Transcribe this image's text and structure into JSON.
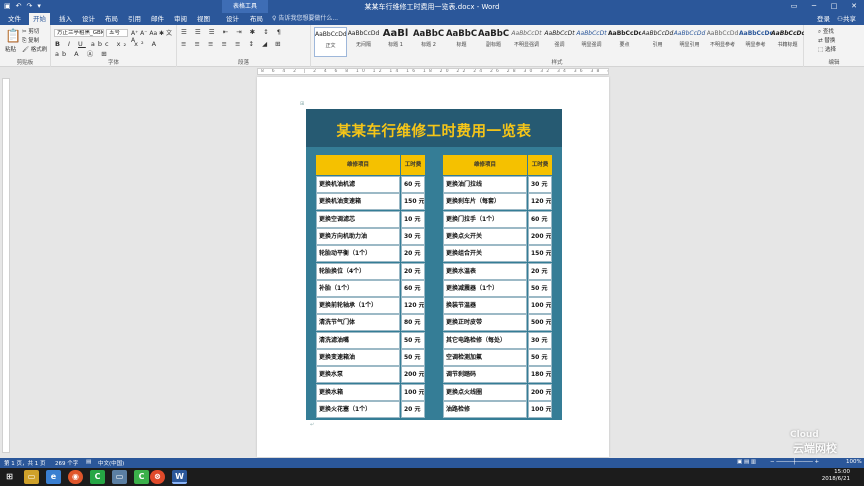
{
  "window": {
    "title": "某某车行维修工时费用一览表.docx - Word",
    "context_tab": "表格工具"
  },
  "tabs": [
    {
      "label": "文件",
      "active": false
    },
    {
      "label": "开始",
      "active": true
    },
    {
      "label": "插入",
      "active": false
    },
    {
      "label": "设计",
      "active": false
    },
    {
      "label": "布局",
      "active": false
    },
    {
      "label": "引用",
      "active": false
    },
    {
      "label": "邮件",
      "active": false
    },
    {
      "label": "审阅",
      "active": false
    },
    {
      "label": "视图",
      "active": false
    },
    {
      "label": "设计",
      "active": false
    },
    {
      "label": "布局",
      "active": false
    }
  ],
  "tell_me": "告诉我您想要做什么...",
  "login": "登录",
  "share": "共享",
  "ribbon": {
    "clipboard": {
      "label": "剪贴板",
      "paste": "粘贴",
      "cut": "剪切",
      "copy": "复制",
      "format_painter": "格式刷"
    },
    "font": {
      "label": "字体",
      "font_name": "方正兰亭粗黑_GBK",
      "font_size": "五号"
    },
    "paragraph": {
      "label": "段落"
    },
    "styles": {
      "label": "样式",
      "items": [
        {
          "preview": "AaBbCcDd",
          "name": "正文"
        },
        {
          "preview": "AaBbCcDd",
          "name": "无间隔"
        },
        {
          "preview": "AaBl",
          "name": "标题 1"
        },
        {
          "preview": "AaBbC",
          "name": "标题 2"
        },
        {
          "preview": "AaBbC",
          "name": "标题"
        },
        {
          "preview": "AaBbC",
          "name": "副标题"
        },
        {
          "preview": "AaBbCcDt",
          "name": "不明显强调"
        },
        {
          "preview": "AaBbCcDt",
          "name": "强调"
        },
        {
          "preview": "AaBbCcDt",
          "name": "明显强调"
        },
        {
          "preview": "AaBbCcDd",
          "name": "要点"
        },
        {
          "preview": "AaBbCcDd",
          "name": "引用"
        },
        {
          "preview": "AaBbCcDd",
          "name": "明显引用"
        },
        {
          "preview": "AaBbCcDd",
          "name": "不明显参考"
        },
        {
          "preview": "AaBbCcDd",
          "name": "明显参考"
        },
        {
          "preview": "AaBbCcDd",
          "name": "书籍标题"
        }
      ]
    },
    "editing": {
      "label": "编辑",
      "find": "查找",
      "replace": "替换",
      "select": "选择"
    }
  },
  "document": {
    "title": "某某车行维修工时费用一览表",
    "header_item": "维修项目",
    "header_fee": "工时费",
    "left": [
      {
        "item": "更换机油机滤",
        "fee": "60 元"
      },
      {
        "item": "更换机油变速箱",
        "fee": "150 元"
      },
      {
        "item": "更换空调滤芯",
        "fee": "10 元"
      },
      {
        "item": "更换方向机助力油",
        "fee": "30 元"
      },
      {
        "item": "轮胎动平衡（1个）",
        "fee": "20 元"
      },
      {
        "item": "轮胎换位（4个）",
        "fee": "20 元"
      },
      {
        "item": "补胎（1个）",
        "fee": "60 元"
      },
      {
        "item": "更换前轮轴承（1个）",
        "fee": "120 元"
      },
      {
        "item": "清洗节气门体",
        "fee": "80 元"
      },
      {
        "item": "清洗滤油嘴",
        "fee": "50 元"
      },
      {
        "item": "更换变速箱油",
        "fee": "50 元"
      },
      {
        "item": "更换水泵",
        "fee": "200 元"
      },
      {
        "item": "更换水箱",
        "fee": "100 元"
      },
      {
        "item": "更换火花塞（1个）",
        "fee": "20 元"
      }
    ],
    "right": [
      {
        "item": "更换油门拉线",
        "fee": "30 元"
      },
      {
        "item": "更换刹车片（每套）",
        "fee": "120 元"
      },
      {
        "item": "更换门拉手（1个）",
        "fee": "60 元"
      },
      {
        "item": "更换点火开关",
        "fee": "200 元"
      },
      {
        "item": "更换组合开关",
        "fee": "150 元"
      },
      {
        "item": "更换水温表",
        "fee": "20 元"
      },
      {
        "item": "更换减震器（1个）",
        "fee": "50 元"
      },
      {
        "item": "换装节温器",
        "fee": "100 元"
      },
      {
        "item": "更换正时皮带",
        "fee": "500 元"
      },
      {
        "item": "其它电路检修（每处）",
        "fee": "30 元"
      },
      {
        "item": "空调检测加氟",
        "fee": "50 元"
      },
      {
        "item": "调节刹踏码",
        "fee": "180 元"
      },
      {
        "item": "更换点火线圈",
        "fee": "200 元"
      },
      {
        "item": "油路检修",
        "fee": "100 元"
      }
    ]
  },
  "status": {
    "page": "第 1 页，共 1 页",
    "words": "269 个字",
    "language": "中文(中国)",
    "zoom": "100%"
  },
  "taskbar": {
    "time": "15:00",
    "date": "2018/6/21"
  },
  "watermark": {
    "top": "Cloud",
    "bottom": "云端网校"
  },
  "colors": {
    "accent": "#2b579a",
    "table_bg": "#357d96",
    "table_head_bg": "#265a72",
    "title_color": "#f5c518",
    "header_yellow": "#f5c100"
  }
}
